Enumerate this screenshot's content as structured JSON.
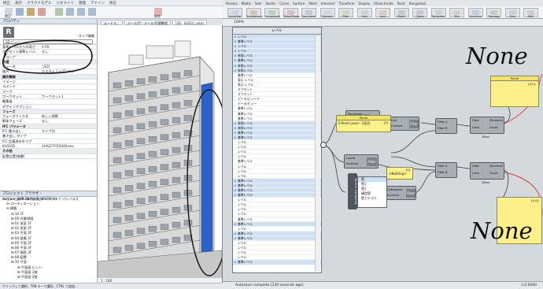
{
  "revit": {
    "ribbon_tabs": [
      "修正",
      "表示",
      "クラウドモデル",
      "ジオメトリ",
      "管理",
      "アドイン",
      "修正"
    ],
    "ribbon_buttons": [
      "修正",
      "貼付",
      "結合",
      "切取",
      "位置合わせ",
      "移動",
      "コピー",
      "回転",
      "削除"
    ],
    "view_tabs": [
      "ムードル...",
      "ルール(Y) - ルール/空間整理",
      "[3D - 04210_sato]"
    ],
    "properties": {
      "title": "プロパティ",
      "type_name": "3D ビュー",
      "type_edit": "タイプ編集",
      "rows": [
        {
          "k": "基準レベルからの高さ",
          "v": "0.00",
          "group": false
        },
        {
          "k": "オフセット基準レベル",
          "v": "なし",
          "group": false
        },
        {
          "k": "スコープ",
          "v": "",
          "group": false
        },
        {
          "k": "共通",
          "v": "",
          "group": true
        },
        {
          "k": "ビュー名",
          "v": "{3D}",
          "group": false
        },
        {
          "k": "縮尺",
          "v": "カスタム 1:+25 mm",
          "group": false
        },
        {
          "k": "識別情報",
          "v": "",
          "group": true
        },
        {
          "k": "イメージ",
          "v": "",
          "group": false
        },
        {
          "k": "コメント",
          "v": "",
          "group": false
        },
        {
          "k": "マーク",
          "v": "",
          "group": false
        },
        {
          "k": "ワークセット",
          "v": "ワークセット1",
          "group": false
        },
        {
          "k": "編集者",
          "v": "",
          "group": false
        },
        {
          "k": "デザインオプション",
          "v": "",
          "group": false
        },
        {
          "k": "フェーズ",
          "v": "",
          "group": true
        },
        {
          "k": "フェーズフィルタ",
          "v": "新しい建築",
          "group": false
        },
        {
          "k": "解体フェーズ",
          "v": "なし",
          "group": false
        },
        {
          "k": "IFC パラメータ",
          "v": "",
          "group": true
        },
        {
          "k": "IFC 書き出し",
          "v": "タイプ別",
          "group": false
        },
        {
          "k": "書き出し タイプ",
          "v": "",
          "group": false
        },
        {
          "k": "IFC 定義済みタイプ",
          "v": "",
          "group": false
        },
        {
          "k": "IfcGUID",
          "v": "2HA2FYFP2HAILexv",
          "group": false
        },
        {
          "k": "その他",
          "v": "",
          "group": true
        },
        {
          "k": "配置位置(階層)",
          "v": "",
          "group": false
        }
      ]
    },
    "browser": {
      "title": "プロジェクト ブラウザ - sample_architecture_s2023.rvt",
      "items": [
        "ビュー(標準 (専門分野/タイプ/ファミリ/レベル))",
        "コーディネーション",
        "建築",
        "10 1F",
        "00 作業領域",
        "01 仮設 1F",
        "02 仮設 2F",
        "03 平面 2F",
        "04 設備 1F",
        "05 平面 2F",
        "06 平面 3F",
        "07 階段 3F",
        "08 配置",
        "10 平面",
        "平面図 ビット",
        "平面図 1階",
        "平面図 2階"
      ]
    },
    "viewbar": "1 : 100",
    "status": "クリックして選択、TAB キーで選択、CTRL で追加..."
  },
  "gh": {
    "tabs": [
      "Params",
      "Maths",
      "Sets",
      "Vector",
      "Curve",
      "Surface",
      "Mesh",
      "Intersect",
      "Transform",
      "Display",
      "Rhino.Inside",
      "Revit",
      "Kangaroo2"
    ],
    "tools": [
      "Annotate",
      "Architecture",
      "Component",
      "DirectShape",
      "Document",
      "Element",
      "Filter",
      "Host",
      "Input",
      "Model",
      "Object Styles",
      "Parameter",
      "Site",
      "Structure",
      "Topology",
      "View",
      "Wall"
    ],
    "canvas_name": "100%",
    "status": "Autosave complete (230 seconds ago)",
    "level_panel": {
      "title": "レベル",
      "rows": [
        {
          "name": "レベル",
          "val": "",
          "sel": true,
          "checked": true
        },
        {
          "name": "基準レベル",
          "val": "",
          "sel": true,
          "checked": true
        },
        {
          "name": "レベル",
          "val": "",
          "sel": true,
          "checked": true
        },
        {
          "name": "レベル",
          "val": "",
          "sel": true,
          "checked": true
        },
        {
          "name": "参照レベル",
          "val": "",
          "sel": true,
          "checked": true
        },
        {
          "name": "基準レベル",
          "val": "",
          "sel": true,
          "checked": true
        },
        {
          "name": "参照レベル",
          "val": "",
          "sel": true,
          "checked": true
        },
        {
          "name": "参照レベル",
          "val": "",
          "sel": true,
          "checked": true
        },
        {
          "name": "基準レベル",
          "val": "",
          "sel": false,
          "checked": false
        },
        {
          "name": "表示 レベル",
          "val": "",
          "sel": false,
          "checked": false
        },
        {
          "name": "表示 レベル",
          "val": "",
          "sel": false,
          "checked": false
        },
        {
          "name": "オフセット",
          "val": "",
          "sel": false,
          "checked": false
        },
        {
          "name": "オフセット",
          "val": "",
          "sel": false,
          "checked": false
        },
        {
          "name": "データ/ビューア",
          "val": "",
          "sel": false,
          "checked": false
        },
        {
          "name": "データ/ビュー",
          "val": "",
          "sel": false,
          "checked": false
        },
        {
          "name": "基準レベル",
          "val": "",
          "sel": false,
          "checked": false
        },
        {
          "name": "基準レベル",
          "val": "",
          "sel": false,
          "checked": false
        },
        {
          "name": "基準レベル",
          "val": "",
          "sel": false,
          "checked": false
        },
        {
          "name": "参照レベル",
          "val": "",
          "sel": true,
          "checked": true
        },
        {
          "name": "参照レベル",
          "val": "",
          "sel": true,
          "checked": true
        },
        {
          "name": "基準レベル",
          "val": "",
          "sel": true,
          "checked": true
        },
        {
          "name": "基準レベル",
          "val": "",
          "sel": true,
          "checked": true
        },
        {
          "name": "レベル",
          "val": "",
          "sel": false,
          "checked": false
        },
        {
          "name": "レベル",
          "val": "",
          "sel": false,
          "checked": false
        },
        {
          "name": "レベル",
          "val": "",
          "sel": false,
          "checked": false
        },
        {
          "name": "レベル",
          "val": "",
          "sel": false,
          "checked": false
        },
        {
          "name": "基準レベル",
          "val": "",
          "sel": false,
          "checked": false
        },
        {
          "name": "レベル",
          "val": "",
          "sel": false,
          "checked": false
        },
        {
          "name": "レベル",
          "val": "",
          "sel": false,
          "checked": false
        },
        {
          "name": "レベル",
          "val": "",
          "sel": false,
          "checked": false
        },
        {
          "name": "基準レベル",
          "val": "",
          "sel": true,
          "checked": true
        },
        {
          "name": "基準レベル",
          "val": "",
          "sel": true,
          "checked": true
        },
        {
          "name": "基準レベル",
          "val": "",
          "sel": true,
          "checked": true
        },
        {
          "name": "基準レベル",
          "val": "",
          "sel": true,
          "checked": true
        },
        {
          "name": "レベル",
          "val": "",
          "sel": false,
          "checked": false
        },
        {
          "name": "レベル",
          "val": "",
          "sel": false,
          "checked": false
        },
        {
          "name": "レベル",
          "val": "",
          "sel": false,
          "checked": false
        },
        {
          "name": "レベル",
          "val": "",
          "sel": false,
          "checked": false
        },
        {
          "name": "基準レベル",
          "val": "",
          "sel": false,
          "checked": false
        },
        {
          "name": "基準レベル",
          "val": "",
          "sel": true,
          "checked": true
        },
        {
          "name": "レベル",
          "val": "",
          "sel": false,
          "checked": false
        },
        {
          "name": "基準レベル",
          "val": "",
          "sel": true,
          "checked": true
        },
        {
          "name": "基準レベル",
          "val": "",
          "sel": true,
          "checked": true
        },
        {
          "name": "レベル",
          "val": "",
          "sel": false,
          "checked": false
        },
        {
          "name": "レベル",
          "val": "",
          "sel": false,
          "checked": false
        },
        {
          "name": "レベル",
          "val": "",
          "sel": false,
          "checked": false
        },
        {
          "name": "レベル",
          "val": "",
          "sel": false,
          "checked": false
        },
        {
          "name": "基準レベル",
          "val": "",
          "sel": true,
          "checked": true
        }
      ]
    },
    "nodes": {
      "rule": {
        "inputs": [
          "Parameter",
          "Value"
        ],
        "name": "Rule",
        "outputs": [
          "Rule",
          "Inverted"
        ]
      },
      "filter1": {
        "label": "Filter"
      },
      "levels": {
        "inputs": [
          "Levels",
          "Inverted"
        ],
        "name": "Filter"
      },
      "filter_and": {
        "label": "Filter A",
        "sub": "Filter B"
      },
      "filter_and2": {
        "label": "Filter A",
        "sub": "Filter B"
      },
      "elements1": {
        "inputs": [
          "Filter",
          "Limit"
        ],
        "name": "Elements",
        "outputs": [
          "Elements",
          "Count"
        ],
        "caption": "28ms"
      },
      "elements2": {
        "inputs": [
          "Filter",
          "Limit"
        ],
        "name": "Elements",
        "outputs": [
          "Elements",
          "Count"
        ],
        "caption": "28ms"
      },
      "categories": {
        "inputs": [
          "Categories",
          "Inverted"
        ],
        "name": "Filter"
      }
    },
    "panels": {
      "panel_left": {
        "title": "Panel",
        "body": "0 Revit Level : 1段目",
        "count": "{0}"
      },
      "panel_small": {
        "title": "",
        "body": "<Nothing>",
        "count": "{0}"
      },
      "panel_top_right": {
        "title": "Panel",
        "body": "",
        "count": "{0;0}"
      },
      "panel_bottom_right": {
        "title": "",
        "body": "",
        "count": "{0;0}"
      }
    },
    "context_menu": [
      "壁",
      "壁1",
      "壁2",
      "構造壁",
      "壁カテゴリ"
    ],
    "side_tab_label": "Built-In Categories",
    "status_right": "1.0.0000"
  },
  "annotations": {
    "top": "None",
    "bottom": "None"
  },
  "colors": {
    "gh_canvas": "#d4d9de",
    "panel_yellow": "#fbf08a",
    "sel_blue": "#cfe1f3",
    "wire": "#3c3c3c",
    "selected_wire": "#d6392b"
  }
}
